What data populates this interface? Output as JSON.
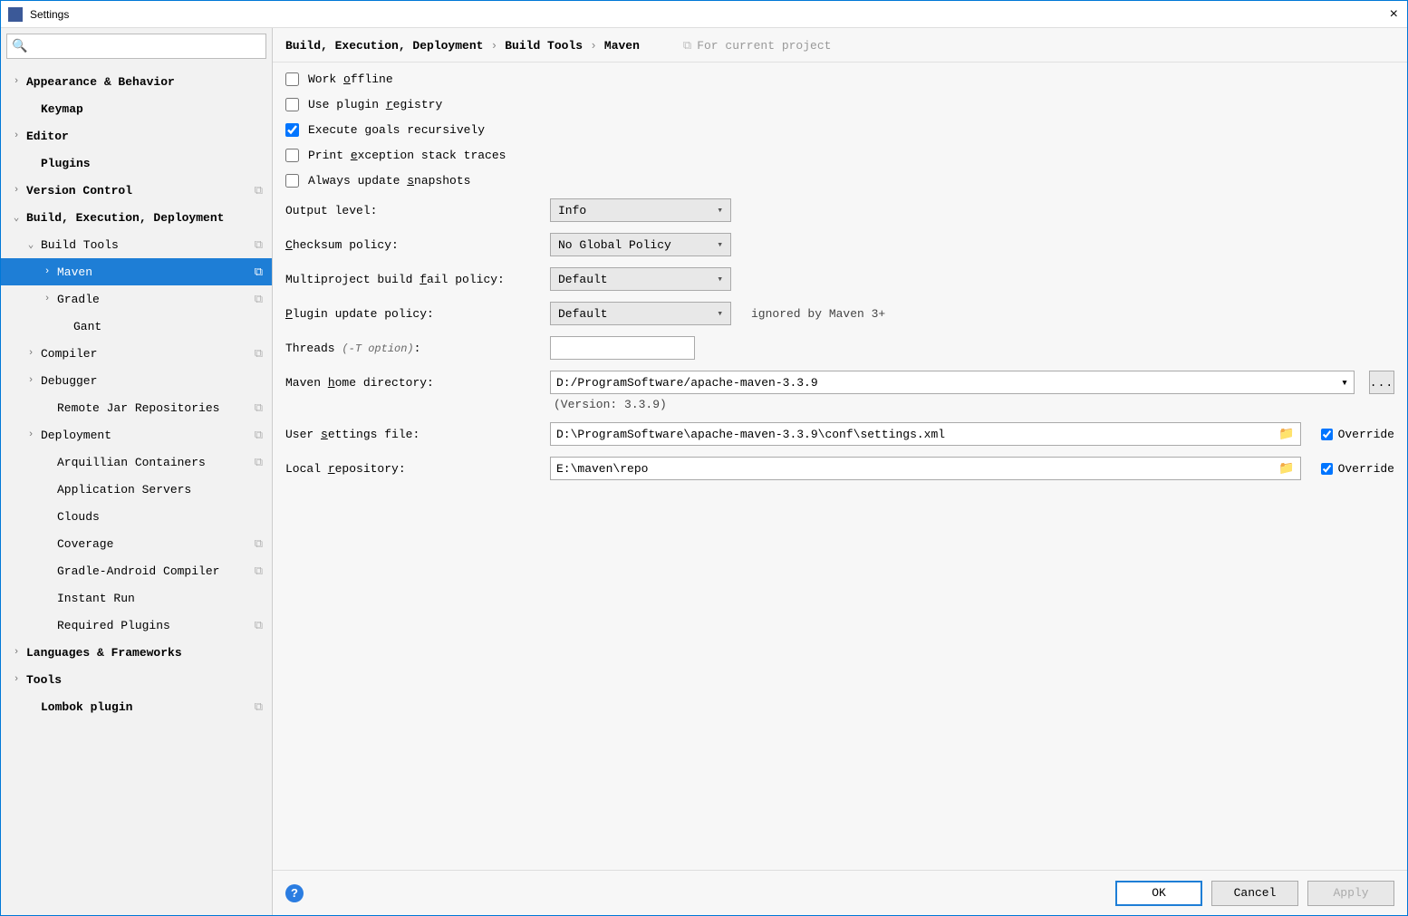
{
  "window": {
    "title": "Settings"
  },
  "search": {
    "placeholder": ""
  },
  "sidebar": {
    "items": [
      {
        "label": "Appearance & Behavior",
        "bold": true,
        "chev": "›",
        "indent": 0,
        "badge": false,
        "sel": false
      },
      {
        "label": "Keymap",
        "bold": true,
        "chev": "",
        "indent": 1,
        "badge": false,
        "sel": false
      },
      {
        "label": "Editor",
        "bold": true,
        "chev": "›",
        "indent": 0,
        "badge": false,
        "sel": false
      },
      {
        "label": "Plugins",
        "bold": true,
        "chev": "",
        "indent": 1,
        "badge": false,
        "sel": false
      },
      {
        "label": "Version Control",
        "bold": true,
        "chev": "›",
        "indent": 0,
        "badge": true,
        "sel": false
      },
      {
        "label": "Build, Execution, Deployment",
        "bold": true,
        "chev": "⌄",
        "indent": 0,
        "badge": false,
        "sel": false
      },
      {
        "label": "Build Tools",
        "bold": false,
        "chev": "⌄",
        "indent": 1,
        "badge": true,
        "sel": false
      },
      {
        "label": "Maven",
        "bold": false,
        "chev": "›",
        "indent": 2,
        "badge": true,
        "sel": true
      },
      {
        "label": "Gradle",
        "bold": false,
        "chev": "›",
        "indent": 2,
        "badge": true,
        "sel": false
      },
      {
        "label": "Gant",
        "bold": false,
        "chev": "",
        "indent": 3,
        "badge": false,
        "sel": false
      },
      {
        "label": "Compiler",
        "bold": false,
        "chev": "›",
        "indent": 1,
        "badge": true,
        "sel": false
      },
      {
        "label": "Debugger",
        "bold": false,
        "chev": "›",
        "indent": 1,
        "badge": false,
        "sel": false
      },
      {
        "label": "Remote Jar Repositories",
        "bold": false,
        "chev": "",
        "indent": 2,
        "badge": true,
        "sel": false
      },
      {
        "label": "Deployment",
        "bold": false,
        "chev": "›",
        "indent": 1,
        "badge": true,
        "sel": false
      },
      {
        "label": "Arquillian Containers",
        "bold": false,
        "chev": "",
        "indent": 2,
        "badge": true,
        "sel": false
      },
      {
        "label": "Application Servers",
        "bold": false,
        "chev": "",
        "indent": 2,
        "badge": false,
        "sel": false
      },
      {
        "label": "Clouds",
        "bold": false,
        "chev": "",
        "indent": 2,
        "badge": false,
        "sel": false
      },
      {
        "label": "Coverage",
        "bold": false,
        "chev": "",
        "indent": 2,
        "badge": true,
        "sel": false
      },
      {
        "label": "Gradle-Android Compiler",
        "bold": false,
        "chev": "",
        "indent": 2,
        "badge": true,
        "sel": false
      },
      {
        "label": "Instant Run",
        "bold": false,
        "chev": "",
        "indent": 2,
        "badge": false,
        "sel": false
      },
      {
        "label": "Required Plugins",
        "bold": false,
        "chev": "",
        "indent": 2,
        "badge": true,
        "sel": false
      },
      {
        "label": "Languages & Frameworks",
        "bold": true,
        "chev": "›",
        "indent": 0,
        "badge": false,
        "sel": false
      },
      {
        "label": "Tools",
        "bold": true,
        "chev": "›",
        "indent": 0,
        "badge": false,
        "sel": false
      },
      {
        "label": "Lombok plugin",
        "bold": true,
        "chev": "",
        "indent": 1,
        "badge": true,
        "sel": false
      }
    ]
  },
  "breadcrumb": {
    "parts": [
      "Build, Execution, Deployment",
      "Build Tools",
      "Maven"
    ],
    "scope": "For current project"
  },
  "form": {
    "checkboxes": {
      "work_offline": {
        "pre": "Work ",
        "u": "o",
        "post": "ffline",
        "checked": false
      },
      "use_plugin_registry": {
        "pre": "Use plugin ",
        "u": "r",
        "post": "egistry",
        "checked": false
      },
      "execute_recursively": {
        "pre": "Execute goals recursively",
        "u": "",
        "post": "",
        "checked": true
      },
      "print_exception": {
        "pre": "Print ",
        "u": "e",
        "post": "xception stack traces",
        "checked": false
      },
      "always_update_snapshots": {
        "pre": "Always update ",
        "u": "s",
        "post": "napshots",
        "checked": false
      }
    },
    "output_level": {
      "label": "Output level:",
      "value": "Info"
    },
    "checksum_policy": {
      "pre": "",
      "u": "C",
      "post": "hecksum policy:",
      "value": "No Global Policy"
    },
    "fail_policy": {
      "pre": "Multiproject build ",
      "u": "f",
      "post": "ail policy:",
      "value": "Default"
    },
    "plugin_update": {
      "pre": "",
      "u": "P",
      "post": "lugin update policy:",
      "value": "Default",
      "note": "ignored by Maven 3+"
    },
    "threads": {
      "label": "Threads ",
      "hint": "(-T option)",
      "colon": ":",
      "value": ""
    },
    "maven_home": {
      "pre": "Maven ",
      "u": "h",
      "post": "ome directory:",
      "value": "D:/ProgramSoftware/apache-maven-3.3.9",
      "version": "(Version: 3.3.9)"
    },
    "user_settings": {
      "pre": "User ",
      "u": "s",
      "post": "ettings file:",
      "value": "D:\\ProgramSoftware\\apache-maven-3.3.9\\conf\\settings.xml",
      "override_label": "Override",
      "override_checked": true
    },
    "local_repo": {
      "pre": "Local ",
      "u": "r",
      "post": "epository:",
      "value": "E:\\maven\\repo",
      "override_label": "Override",
      "override_checked": true
    }
  },
  "footer": {
    "ok": "OK",
    "cancel": "Cancel",
    "apply": "Apply"
  }
}
